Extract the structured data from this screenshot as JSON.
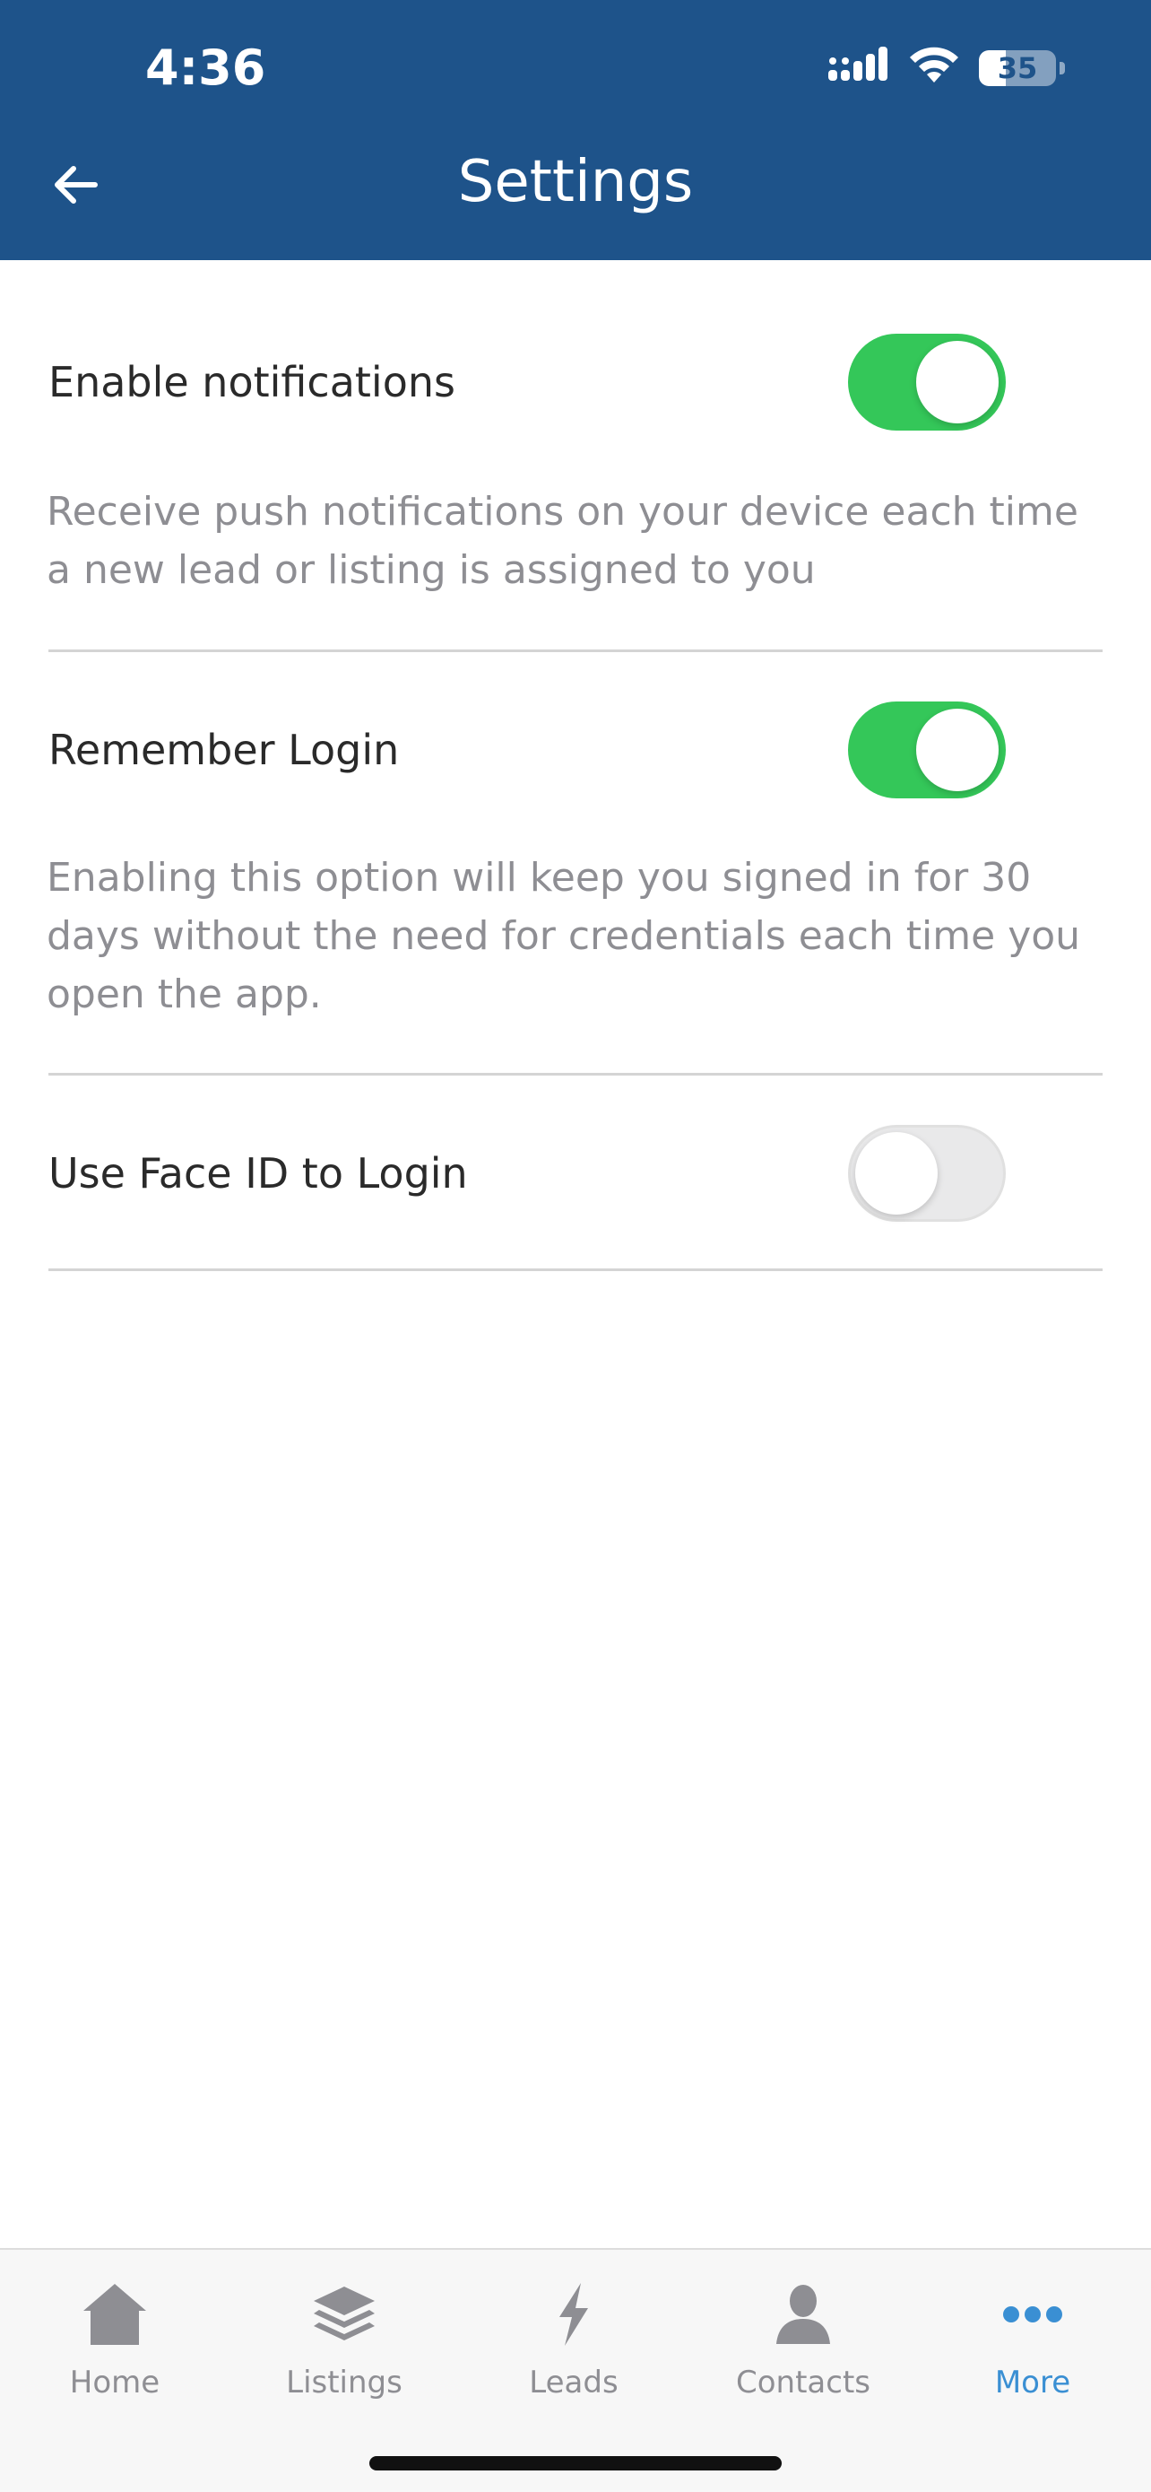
{
  "status_bar": {
    "time": "4:36",
    "battery_level": "35",
    "battery_fraction": 0.35,
    "icons": [
      "cellular-signal-icon",
      "wifi-icon",
      "battery-icon"
    ]
  },
  "header": {
    "title": "Settings",
    "back_icon": "arrow-left-icon",
    "background_color": "#1e538a"
  },
  "settings": [
    {
      "label": "Enable notifications",
      "description": "Receive push notifications on your device each time a new lead or listing is assigned to you",
      "enabled": true
    },
    {
      "label": "Remember Login",
      "description": "Enabling this option will keep you signed in for 30 days without the need for credentials each time you open the app.",
      "enabled": true
    },
    {
      "label": "Use Face ID to Login",
      "description": "",
      "enabled": false
    }
  ],
  "toggle_on_color": "#34c759",
  "tabbar": {
    "active_color": "#3a8fd3",
    "tabs": [
      {
        "label": "Home",
        "icon": "home-icon",
        "active": false
      },
      {
        "label": "Listings",
        "icon": "layers-icon",
        "active": false
      },
      {
        "label": "Leads",
        "icon": "lightning-icon",
        "active": false
      },
      {
        "label": "Contacts",
        "icon": "person-icon",
        "active": false
      },
      {
        "label": "More",
        "icon": "more-dots-icon",
        "active": true
      }
    ]
  }
}
